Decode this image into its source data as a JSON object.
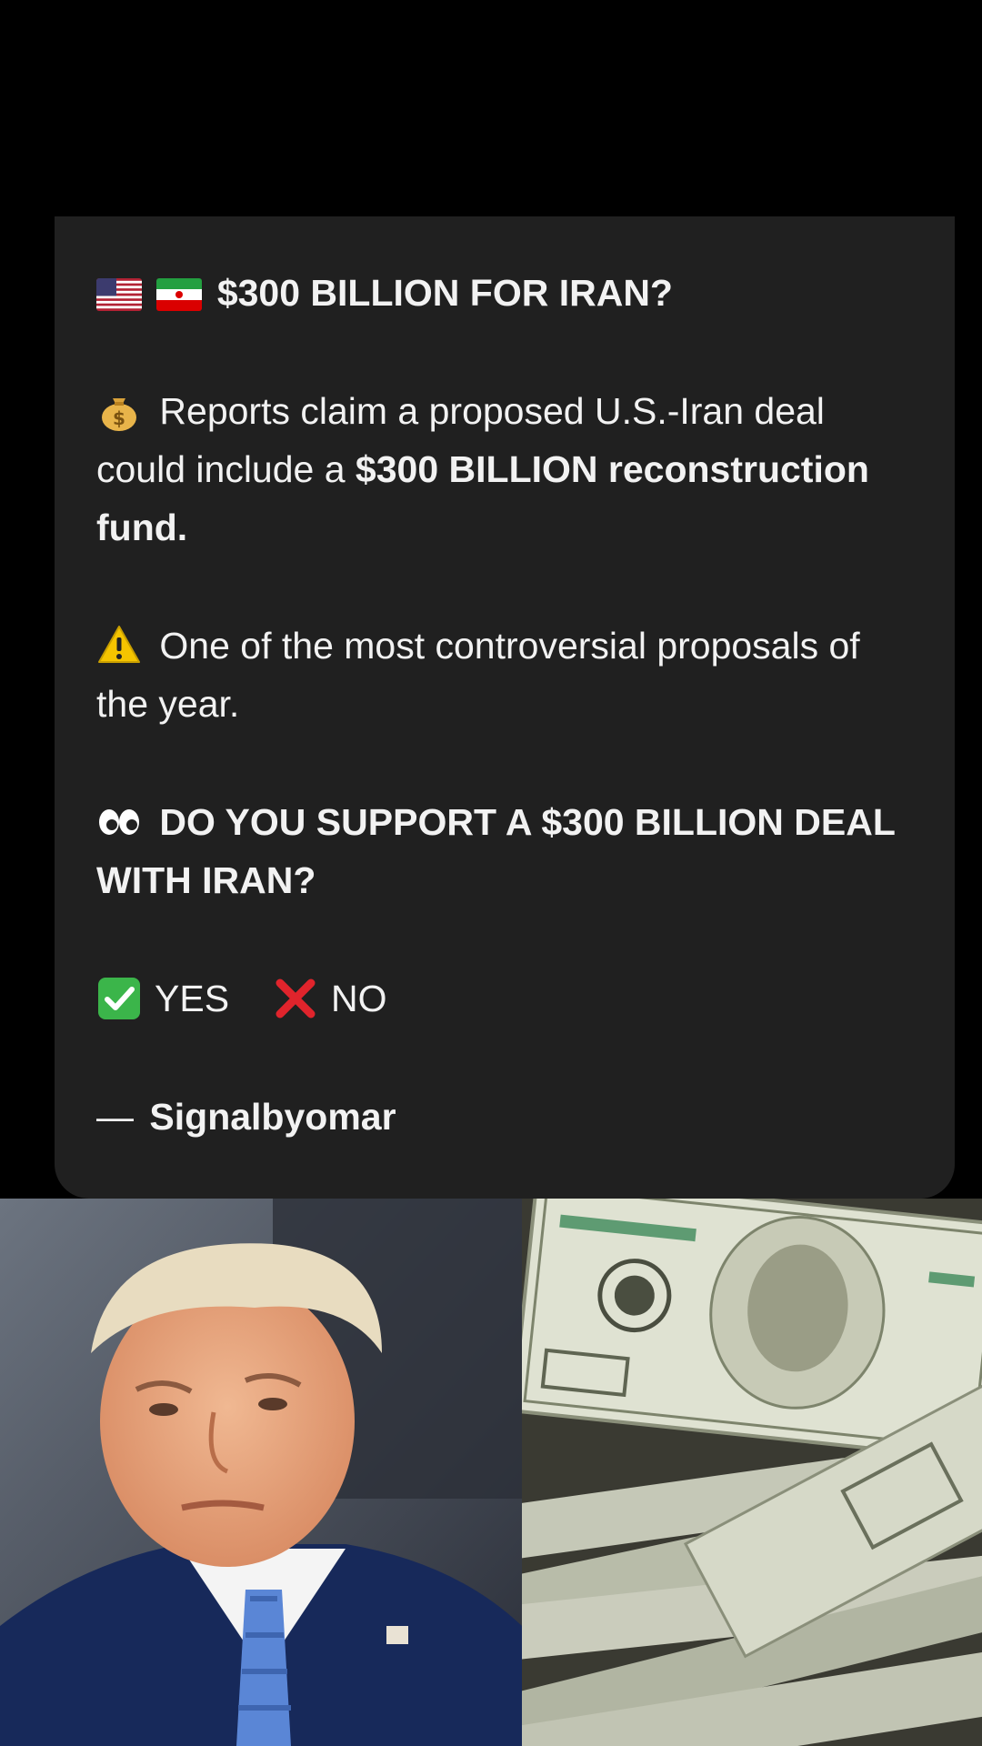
{
  "post": {
    "headline": "$300 BILLION FOR IRAN?",
    "flags": [
      "us-flag-icon",
      "iran-flag-icon"
    ],
    "paragraph1_prefix": "Reports claim a proposed U.S.-Iran deal could include a ",
    "paragraph1_bold": "$300 BILLION reconstruction fund.",
    "paragraph1_icon": "money-bag-icon",
    "paragraph2": "One of the most controversial proposals of the year.",
    "paragraph2_icon": "warning-icon",
    "question": "DO YOU SUPPORT A $300 BILLION DEAL WITH IRAN?",
    "question_icon": "eyes-icon",
    "vote_yes": "YES",
    "vote_no": "NO",
    "signature_dash": "—",
    "signature": "Signalbyomar"
  },
  "images": [
    {
      "name": "portrait-photo"
    },
    {
      "name": "money-stack-photo"
    }
  ],
  "colors": {
    "background": "#000000",
    "card": "#202020",
    "text": "#f2f2f2",
    "check_green": "#3bb54a",
    "cross_red": "#e0242c",
    "warning_yellow": "#f5c400"
  }
}
